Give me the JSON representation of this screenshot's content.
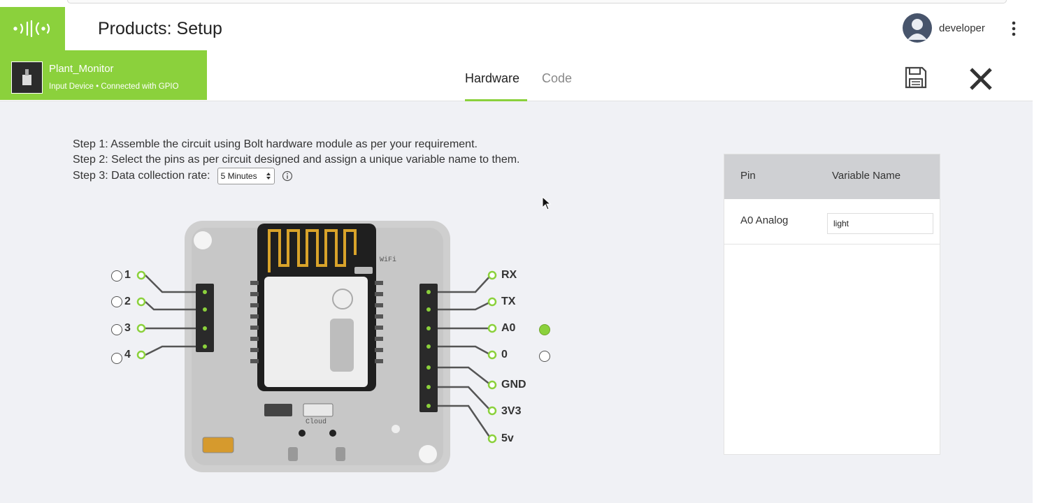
{
  "header": {
    "title": "Products: Setup",
    "username": "developer"
  },
  "device": {
    "name": "Plant_Monitor",
    "status": "Input Device • Connected with GPIO"
  },
  "tabs": [
    {
      "label": "Hardware",
      "active": true
    },
    {
      "label": "Code",
      "active": false
    }
  ],
  "steps": {
    "step1": "Step 1: Assemble the circuit using Bolt hardware module as per your requirement.",
    "step2": "Step 2: Select the pins as per circuit designed and assign a unique variable name to them.",
    "step3_label": "Step 3: Data collection rate:",
    "rate_selected": "5 Minutes"
  },
  "board": {
    "left_pins": [
      "1",
      "2",
      "3",
      "4"
    ],
    "right_pins": [
      "RX",
      "TX",
      "A0",
      "0",
      "GND",
      "3V3",
      "5v"
    ],
    "chip_label": "WiFi",
    "cloud_label": "Cloud",
    "selected_pin": "A0"
  },
  "pin_table": {
    "headers": {
      "pin": "Pin",
      "variable": "Variable Name"
    },
    "rows": [
      {
        "pin": "A0 Analog",
        "variable": "light"
      }
    ]
  },
  "colors": {
    "brand_green": "#8bd13c",
    "header_gray": "#cfd0d3",
    "background": "#f0f1f5"
  },
  "icons": {
    "save": "floppy-disk-icon",
    "close": "close-x-icon",
    "menu": "kebab-menu-icon",
    "info": "info-circle-icon"
  }
}
